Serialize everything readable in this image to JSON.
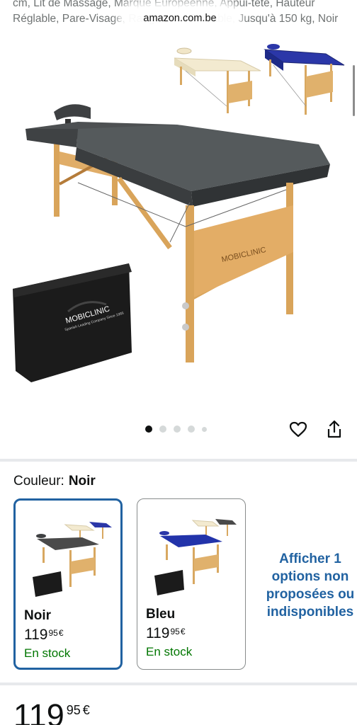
{
  "product": {
    "title_fragment": "cm, Lit de Massage, Marque Européenne, Appui-tête, Hauteur Réglable, Pare-Visage, Rangement, Portable, Jusqu'à 150 kg, Noir",
    "brand_on_image": "MOBICLINIC",
    "bag_subtitle": "Spanish Leading Company Since 1985"
  },
  "browser": {
    "url": "amazon.com.be"
  },
  "gallery": {
    "image_count": 5,
    "active_index": 0
  },
  "actions": {
    "wishlist_icon": "heart-icon",
    "share_icon": "share-icon"
  },
  "color_selector": {
    "label": "Couleur:",
    "selected": "Noir"
  },
  "variants": [
    {
      "name": "Noir",
      "price_whole": "119",
      "price_fraction": "95",
      "currency": "€",
      "stock": "En stock",
      "selected": true,
      "table_color": "#4a4a4a"
    },
    {
      "name": "Bleu",
      "price_whole": "119",
      "price_fraction": "95",
      "currency": "€",
      "stock": "En stock",
      "selected": false,
      "table_color": "#2233aa"
    }
  ],
  "other_options_link": "Afficher 1 options non proposées ou indisponibles",
  "price": {
    "whole": "119",
    "fraction": "95",
    "currency": "€"
  },
  "colors": {
    "accent_link": "#2162a1",
    "in_stock": "#007600",
    "selected_border": "#2162a1"
  }
}
